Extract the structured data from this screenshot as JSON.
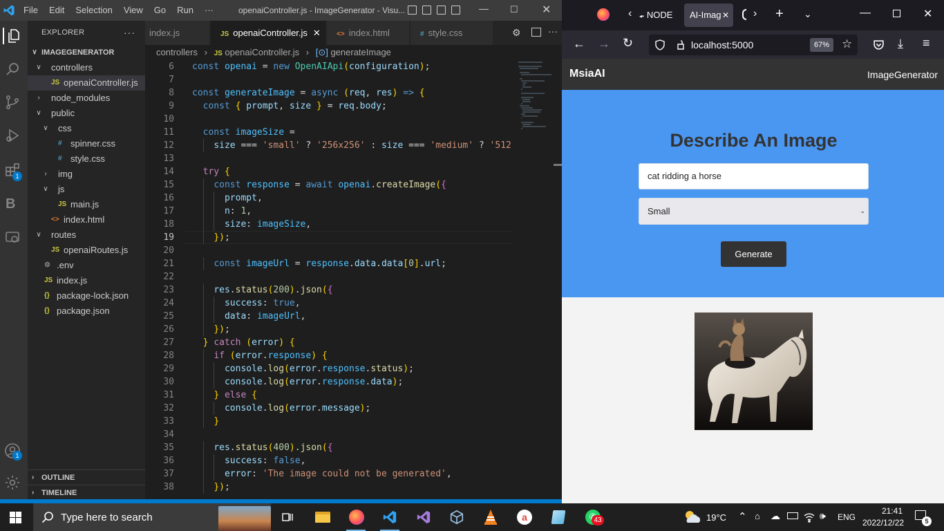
{
  "vscode": {
    "menu": [
      "File",
      "Edit",
      "Selection",
      "View",
      "Go",
      "Run",
      "···"
    ],
    "window_title": "openaiController.js - ImageGenerator - Visu...",
    "explorer": {
      "title": "EXPLORER",
      "project": "IMAGEGENERATOR",
      "items": [
        {
          "label": "controllers",
          "type": "folder-open"
        },
        {
          "label": "openaiController.js",
          "type": "js"
        },
        {
          "label": "node_modules",
          "type": "folder"
        },
        {
          "label": "public",
          "type": "folder-open"
        },
        {
          "label": "css",
          "type": "folder-open"
        },
        {
          "label": "spinner.css",
          "type": "css"
        },
        {
          "label": "style.css",
          "type": "css"
        },
        {
          "label": "img",
          "type": "folder"
        },
        {
          "label": "js",
          "type": "folder-open"
        },
        {
          "label": "main.js",
          "type": "js"
        },
        {
          "label": "index.html",
          "type": "html"
        },
        {
          "label": "routes",
          "type": "folder-open"
        },
        {
          "label": "openaiRoutes.js",
          "type": "js"
        },
        {
          "label": ".env",
          "type": "gear"
        },
        {
          "label": "index.js",
          "type": "js"
        },
        {
          "label": "package-lock.json",
          "type": "json"
        },
        {
          "label": "package.json",
          "type": "json"
        }
      ],
      "outline": "OUTLINE",
      "timeline": "TIMELINE"
    },
    "activity_badges": {
      "extensions": "1",
      "accounts": "1"
    },
    "tabs": [
      {
        "label": "index.js",
        "icon": "JS"
      },
      {
        "label": "openaiController.js",
        "icon": "JS"
      },
      {
        "label": "index.html",
        "icon": "<>"
      },
      {
        "label": "style.css",
        "icon": "#"
      }
    ],
    "breadcrumb": {
      "folder": "controllers",
      "file": "openaiController.js",
      "symbol": "generateImage"
    },
    "code_lines": [
      {
        "n": "6",
        "t": "const openai = new OpenAIApi(configuration);"
      },
      {
        "n": "7",
        "t": ""
      },
      {
        "n": "8",
        "t": "const generateImage = async (req, res) => {"
      },
      {
        "n": "9",
        "t": "  const { prompt, size } = req.body;"
      },
      {
        "n": "10",
        "t": ""
      },
      {
        "n": "11",
        "t": "  const imageSize ="
      },
      {
        "n": "12",
        "t": "    size === 'small' ? '256x256' : size === 'medium' ? '512"
      },
      {
        "n": "13",
        "t": ""
      },
      {
        "n": "14",
        "t": "  try {"
      },
      {
        "n": "15",
        "t": "    const response = await openai.createImage({"
      },
      {
        "n": "16",
        "t": "      prompt,"
      },
      {
        "n": "17",
        "t": "      n: 1,"
      },
      {
        "n": "18",
        "t": "      size: imageSize,"
      },
      {
        "n": "19",
        "t": "    });"
      },
      {
        "n": "20",
        "t": ""
      },
      {
        "n": "21",
        "t": "    const imageUrl = response.data.data[0].url;"
      },
      {
        "n": "22",
        "t": ""
      },
      {
        "n": "23",
        "t": "    res.status(200).json({"
      },
      {
        "n": "24",
        "t": "      success: true,"
      },
      {
        "n": "25",
        "t": "      data: imageUrl,"
      },
      {
        "n": "26",
        "t": "    });"
      },
      {
        "n": "27",
        "t": "  } catch (error) {"
      },
      {
        "n": "28",
        "t": "    if (error.response) {"
      },
      {
        "n": "29",
        "t": "      console.log(error.response.status);"
      },
      {
        "n": "30",
        "t": "      console.log(error.response.data);"
      },
      {
        "n": "31",
        "t": "    } else {"
      },
      {
        "n": "32",
        "t": "      console.log(error.message);"
      },
      {
        "n": "33",
        "t": "    }"
      },
      {
        "n": "34",
        "t": ""
      },
      {
        "n": "35",
        "t": "    res.status(400).json({"
      },
      {
        "n": "36",
        "t": "      success: false,"
      },
      {
        "n": "37",
        "t": "      error: 'The image could not be generated',"
      },
      {
        "n": "38",
        "t": "    });"
      }
    ],
    "current_line": "19"
  },
  "firefox": {
    "tabs": [
      {
        "label": "NODE"
      },
      {
        "label": "AI-Imag"
      }
    ],
    "url": "localhost:5000",
    "zoom": "67%",
    "page": {
      "logo": "MsiaAI",
      "nav_link": "ImageGenerator",
      "heading": "Describe An Image",
      "prompt_value": "cat ridding a horse",
      "size_selected": "Small",
      "button": "Generate"
    }
  },
  "taskbar": {
    "search_placeholder": "Type here to search",
    "weather": "19°C",
    "language": "ENG",
    "time": "21:41",
    "date": "2022/12/22",
    "whatsapp_badge": "43",
    "notifications": "5"
  },
  "colors": {
    "vscode_accent": "#007acc",
    "hero_blue": "#4a97f2",
    "dark": "#333333"
  }
}
